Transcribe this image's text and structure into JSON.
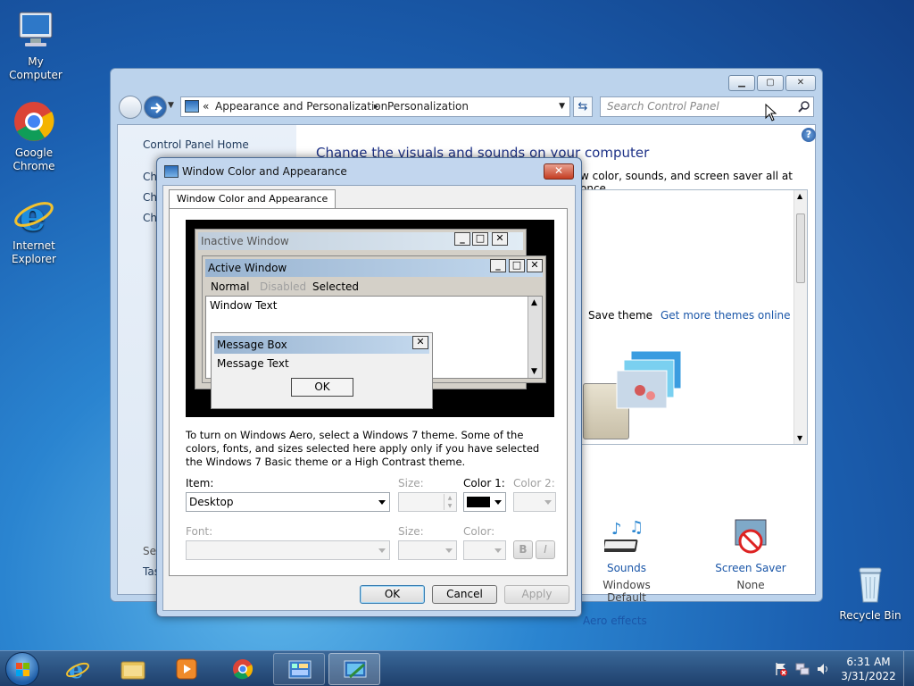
{
  "desktop": {
    "icons": [
      {
        "label": "My Computer"
      },
      {
        "label": "Google Chrome"
      },
      {
        "label": "Internet Explorer"
      },
      {
        "label": "Recycle Bin"
      }
    ]
  },
  "control_panel": {
    "address": {
      "crumb_prefix": "«",
      "crumbs": [
        "Appearance and Personalization",
        "Personalization"
      ],
      "separator": "▸"
    },
    "search_placeholder": "Search Control Panel",
    "sidebar": {
      "home": "Control Panel Home",
      "items_partial": [
        "Ch",
        "Ch",
        "Ch"
      ],
      "see_also_partial": "See",
      "task_partial": "Tas"
    },
    "heading": "Change the visuals and sounds on your computer",
    "subtext_partial": "w color, sounds, and screen saver all at once.",
    "save_theme": "Save theme",
    "more_themes": "Get more themes online",
    "sounds": {
      "label": "Sounds",
      "value": "Windows Default"
    },
    "screen_saver": {
      "label": "Screen Saver",
      "value": "None"
    },
    "aero_partial": "Aero effects"
  },
  "dialog": {
    "title": "Window Color and Appearance",
    "close": "✕",
    "tab": "Window Color and Appearance",
    "preview": {
      "inactive_title": "Inactive Window",
      "active_title": "Active Window",
      "menu": {
        "normal": "Normal",
        "disabled": "Disabled",
        "selected": "Selected"
      },
      "window_text": "Window Text",
      "msgbox_title": "Message Box",
      "msgbox_text": "Message Text",
      "msgbox_ok": "OK"
    },
    "info": "To turn on Windows Aero, select a Windows 7 theme.  Some of the colors, fonts, and sizes selected here apply only if you have selected the Windows 7 Basic theme or a High Contrast theme.",
    "item_label": "Item:",
    "item_value": "Desktop",
    "size_label": "Size:",
    "color1_label": "Color 1:",
    "color1_value": "#000000",
    "color2_label": "Color 2:",
    "font_label": "Font:",
    "font_size_label": "Size:",
    "font_color_label": "Color:",
    "bold": "B",
    "italic": "I",
    "ok": "OK",
    "cancel": "Cancel",
    "apply": "Apply"
  },
  "taskbar": {
    "time": "6:31 AM",
    "date": "3/31/2022"
  },
  "colors": {
    "accent": "#1a56a8",
    "selected_title": "#99b4d1",
    "inactive_title": "#bfcddb"
  }
}
